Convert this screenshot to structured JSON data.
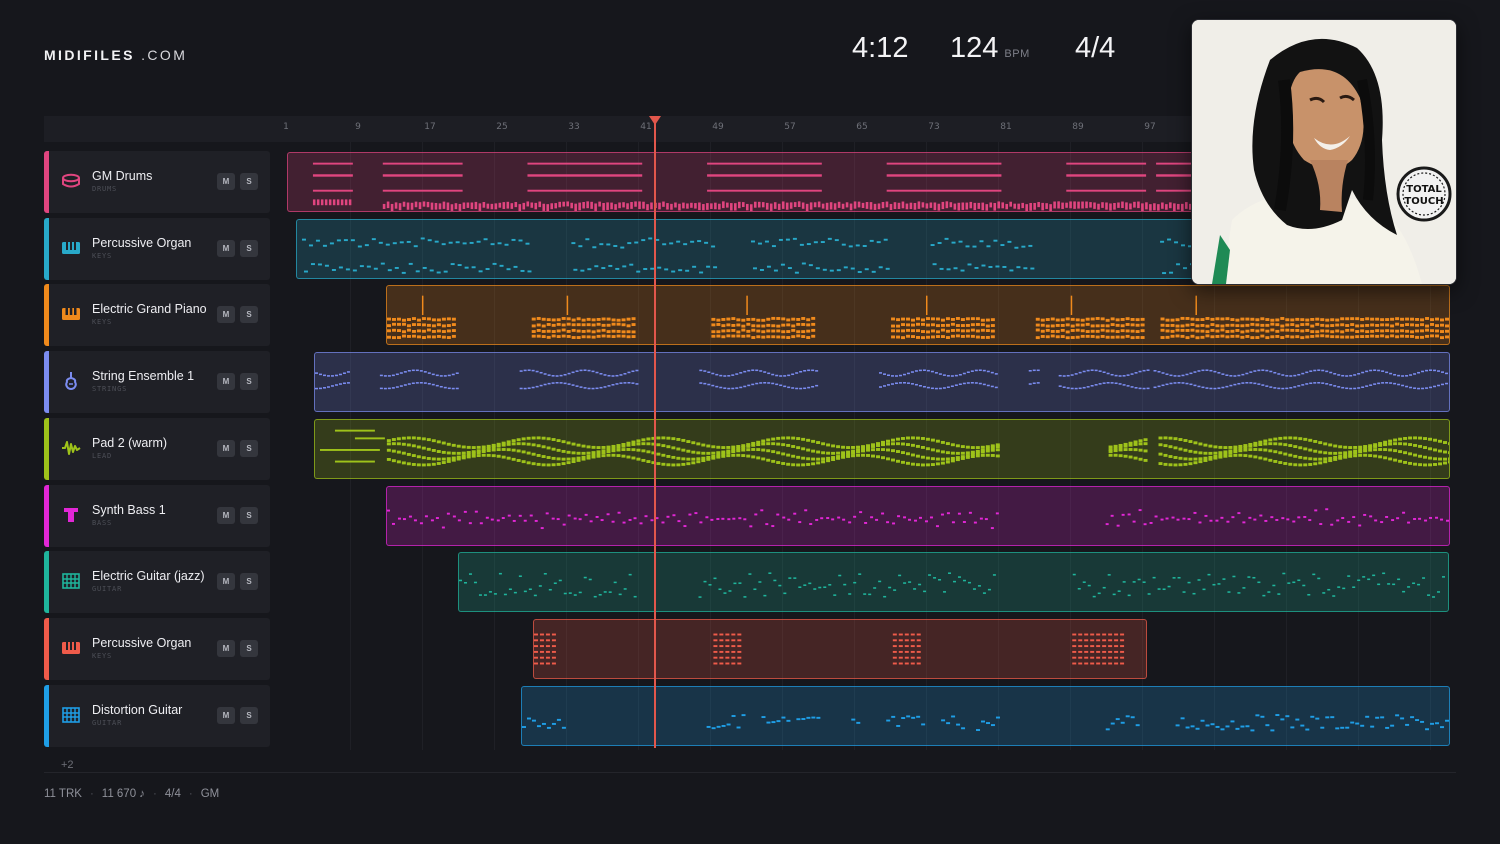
{
  "brand": {
    "name_bold": "MIDIFILES",
    "name_light": ".COM"
  },
  "transport": {
    "time": "4:12",
    "bpm": "124",
    "bpm_unit": "BPM",
    "time_signature": "4/4"
  },
  "ruler": {
    "bars": [
      "1",
      "9",
      "17",
      "25",
      "33",
      "41",
      "49",
      "57",
      "65",
      "73",
      "81",
      "89",
      "97"
    ]
  },
  "playhead_bar": 41,
  "tracks": [
    {
      "name": "GM Drums",
      "category": "DRUMS",
      "color": "#e0457f",
      "icon": "drum-icon",
      "mute": "M",
      "solo": "S"
    },
    {
      "name": "Percussive Organ",
      "category": "KEYS",
      "color": "#28a9c9",
      "icon": "organ-keys-icon",
      "mute": "M",
      "solo": "S"
    },
    {
      "name": "Electric Grand Piano",
      "category": "KEYS",
      "color": "#f08a1c",
      "icon": "piano-keys-icon",
      "mute": "M",
      "solo": "S"
    },
    {
      "name": "String Ensemble 1",
      "category": "STRINGS",
      "color": "#7b8cf0",
      "icon": "violin-icon",
      "mute": "M",
      "solo": "S"
    },
    {
      "name": "Pad 2 (warm)",
      "category": "LEAD",
      "color": "#9ec21a",
      "icon": "waveform-icon",
      "mute": "M",
      "solo": "S"
    },
    {
      "name": "Synth Bass 1",
      "category": "BASS",
      "color": "#e227d6",
      "icon": "bass-speaker-icon",
      "mute": "M",
      "solo": "S"
    },
    {
      "name": "Electric Guitar (jazz)",
      "category": "GUITAR",
      "color": "#1fb59c",
      "icon": "guitar-fretboard-icon",
      "mute": "M",
      "solo": "S"
    },
    {
      "name": "Percussive Organ",
      "category": "KEYS",
      "color": "#ef5b4a",
      "icon": "organ-keys-icon",
      "mute": "M",
      "solo": "S"
    },
    {
      "name": "Distortion Guitar",
      "category": "GUITAR",
      "color": "#1f9ee6",
      "icon": "guitar-fretboard-icon",
      "mute": "M",
      "solo": "S"
    }
  ],
  "more_tracks": "+2",
  "footer": {
    "tracks": "11 TRK",
    "notes": "11 670 ♪",
    "signature": "4/4",
    "standard": "GM"
  },
  "cover": {
    "badge_line1": "TOTAL",
    "badge_line2": "TOUCH"
  }
}
